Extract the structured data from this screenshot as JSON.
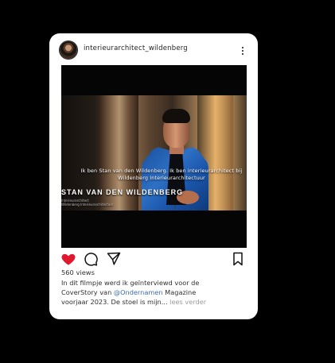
{
  "post": {
    "username": "interieurarchitect_wildenberg",
    "views": "560 views",
    "caption": {
      "line1": "In dit filmpje werd ik geïnterviewd voor de",
      "line2_before_mention": "CoverStory van ",
      "mention": "@Ondernamen",
      "line2_after_mention": " Magazine",
      "line3": "voorjaar 2023. De stoel is mijn...",
      "read_more": "lees verder"
    },
    "video": {
      "subtitle": "Ik ben Stan van den Wildenberg. Ik ben interieurarchitect bij\nWildenberg Interieurarchitectuur",
      "lower_third_name": "STAN VAN DEN WILDENBERG",
      "lower_third_role": "Interieurarchitect\nWildenberg Interieurarchitectuur"
    }
  },
  "icons": {
    "avatar": "profile-avatar-icon",
    "more": "vertical-ellipsis-icon",
    "like": "heart-filled-icon",
    "comment": "speech-bubble-icon",
    "share": "paper-plane-icon",
    "save": "bookmark-icon"
  },
  "colors": {
    "like": "#e0192f",
    "mention": "#3b6fa8",
    "read_more": "#9b9b9b",
    "card_background": "#ffffff",
    "page_background": "#000000"
  }
}
